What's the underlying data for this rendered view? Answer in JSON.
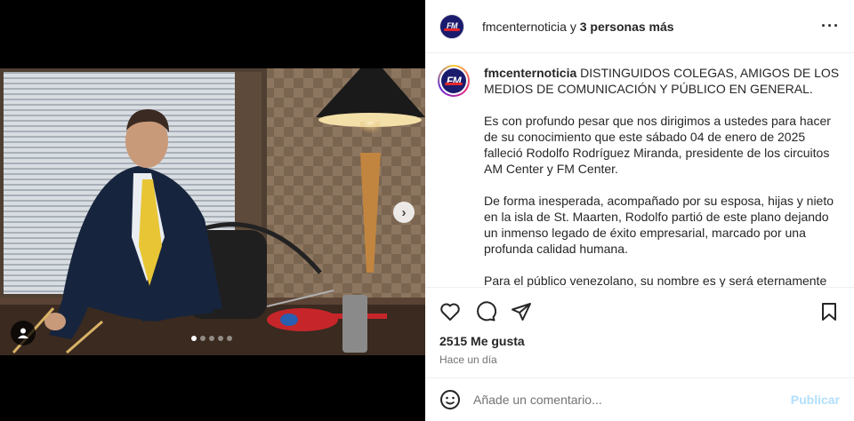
{
  "post": {
    "author": "fmcenternoticia",
    "coauthors_connector": "y",
    "coauthors_label": "3 personas más",
    "avatar_logo_text": "FM",
    "more_icon": "more-options-icon",
    "caption_paragraphs": [
      "DISTINGUIDOS COLEGAS, AMIGOS DE LOS MEDIOS DE COMUNICACIÓN Y PÚBLICO EN GENERAL.",
      "Es con profundo pesar que nos dirigimos a ustedes para hacer de su conocimiento que este sábado 04 de enero de 2025 falleció Rodolfo Rodríguez Miranda, presidente de los circuitos AM Center y FM Center.",
      "De forma inesperada, acompañado por su esposa, hijas y nieto en la isla de St. Maarten, Rodolfo partió de este plano dejando un inmenso legado de éxito empresarial, marcado por una profunda calidad humana.",
      "Para el público venezolano, su nombre es y será eternamente"
    ],
    "likes": "2515 Me gusta",
    "time": "Hace un día",
    "comment_placeholder": "Añade un comentario...",
    "publish_label": "Publicar"
  },
  "carousel": {
    "next_icon": "chevron-right-icon",
    "slides_total": 5,
    "active_slide": 0
  },
  "colors": {
    "publish_disabled": "#b2dffc",
    "brand_blue": "#1b1b6e",
    "brand_red": "#e3262b"
  }
}
